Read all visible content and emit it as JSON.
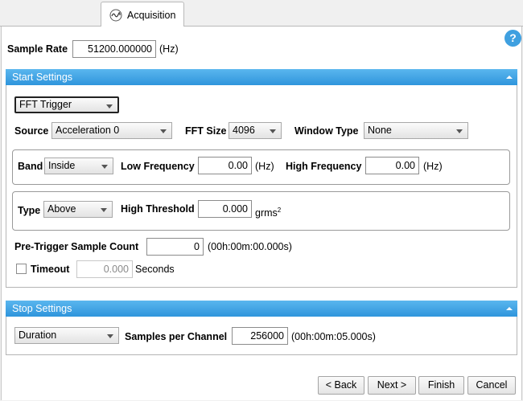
{
  "tab": {
    "label": "Acquisition"
  },
  "help": {
    "label": "?"
  },
  "sample_rate": {
    "label": "Sample Rate",
    "value": "51200.000000",
    "unit": "(Hz)"
  },
  "start_settings": {
    "title": "Start Settings",
    "trigger_type": "FFT Trigger",
    "source": {
      "label": "Source",
      "value": "Acceleration 0"
    },
    "fft_size": {
      "label": "FFT Size",
      "value": "4096"
    },
    "window_type": {
      "label": "Window Type",
      "value": "None"
    },
    "band": {
      "label": "Band",
      "value": "Inside",
      "low_label": "Low Frequency",
      "low_value": "0.00",
      "low_unit": "(Hz)",
      "high_label": "High Frequency",
      "high_value": "0.00",
      "high_unit": "(Hz)"
    },
    "threshold": {
      "type_label": "Type",
      "type_value": "Above",
      "high_label": "High Threshold",
      "high_value": "0.000",
      "unit_base": "grms",
      "unit_exp": "2"
    },
    "pretrigger": {
      "label": "Pre-Trigger Sample Count",
      "value": "0",
      "time": "(00h:00m:00.000s)"
    },
    "timeout": {
      "label": "Timeout",
      "checked": false,
      "value": "0.000",
      "unit": "Seconds"
    }
  },
  "stop_settings": {
    "title": "Stop Settings",
    "mode": "Duration",
    "samples_label": "Samples per Channel",
    "samples_value": "256000",
    "time": "(00h:00m:05.000s)"
  },
  "buttons": {
    "back": "< Back",
    "next": "Next >",
    "finish": "Finish",
    "cancel": "Cancel"
  }
}
